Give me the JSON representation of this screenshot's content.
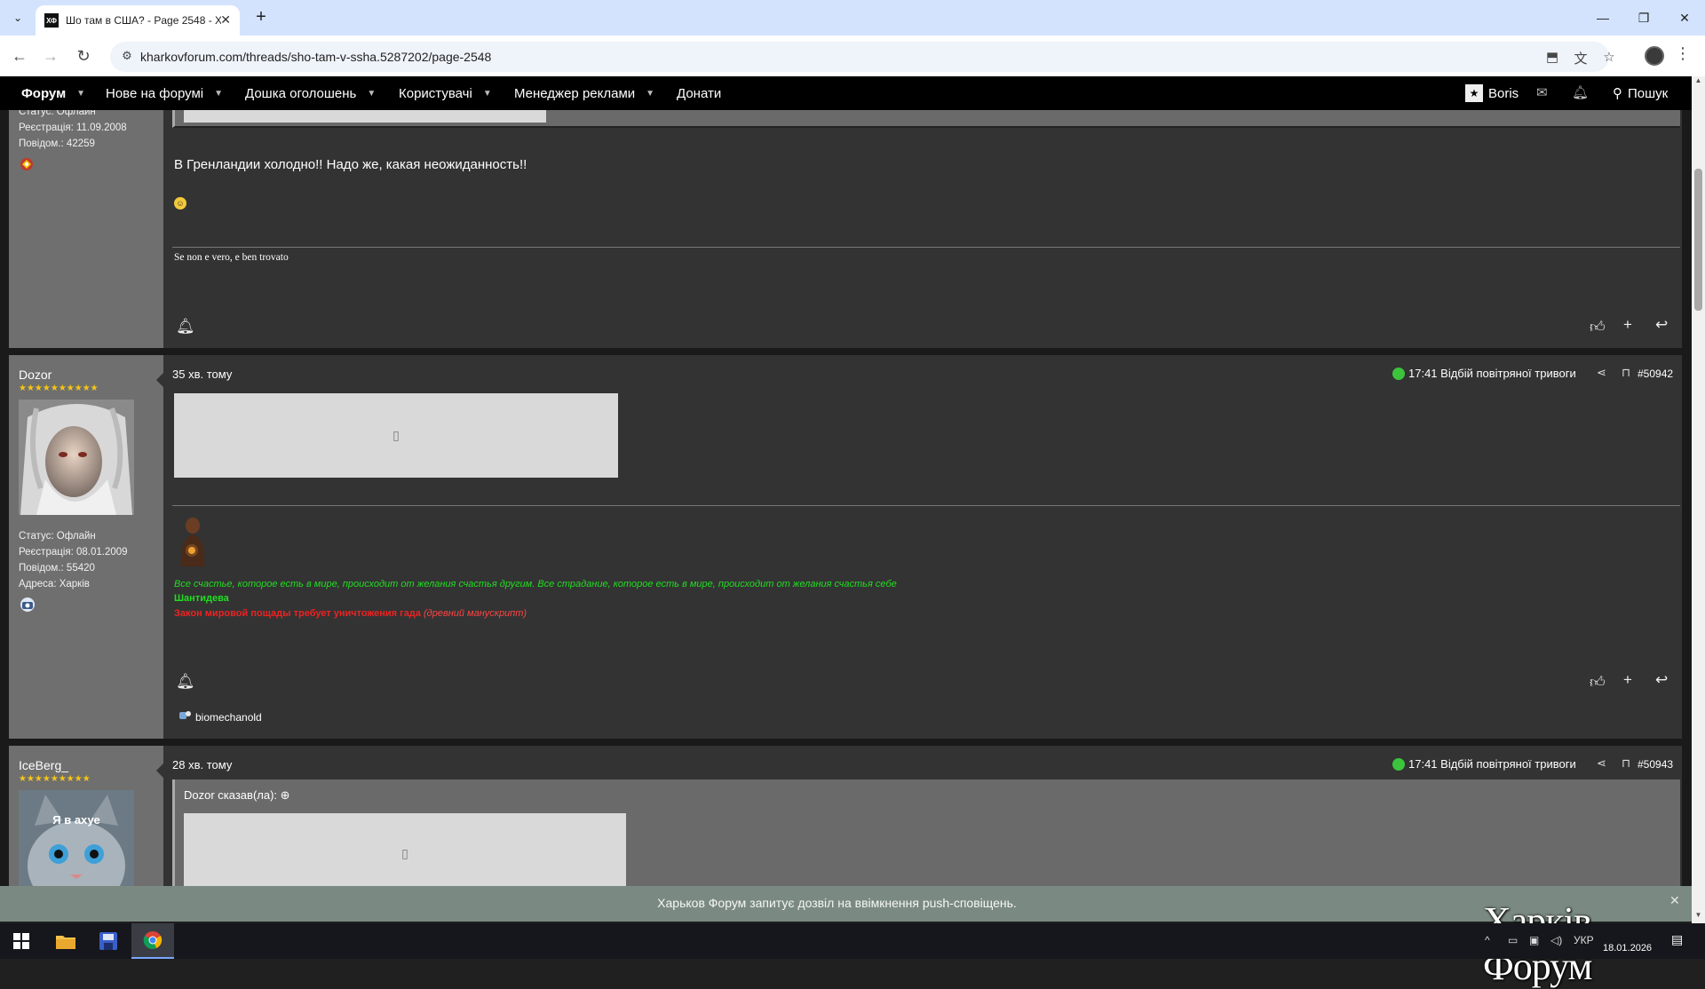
{
  "browser": {
    "tab_favicon": "ХФ",
    "tab_title": "Шо там в США? - Page 2548 - Х",
    "url": "kharkovforum.com/threads/sho-tam-v-ssha.5287202/page-2548"
  },
  "nav": {
    "items": [
      {
        "label": "Форум"
      },
      {
        "label": "Нове на форумі"
      },
      {
        "label": "Дошка оголошень"
      },
      {
        "label": "Користувачі"
      },
      {
        "label": "Менеджер реклами"
      },
      {
        "label": "Донати"
      }
    ],
    "user": "Boris",
    "search": "Пошук"
  },
  "post1": {
    "status": "Статус: Офлайн",
    "registered": "Реєстрація: 11.09.2008",
    "posts": "Повідом.: 42259",
    "text": "В Гренландии холодно!! Надо же, какая неожиданность!!",
    "signature": "Se non e vero, e ben trovato"
  },
  "post2": {
    "username": "Dozor",
    "stars": "★★★★★★★★★★",
    "status": "Статус: Офлайн",
    "registered": "Реєстрація: 08.01.2009",
    "posts": "Повідом.: 55420",
    "address": "Адреса: Харків",
    "time": "35 хв. тому",
    "alert": "17:41 Відбій повітряної тривоги",
    "number": "#50942",
    "sig_line1": "Все счастье, которое есть в мире, происходит от желания счастья другим. Все страдание, которое есть в мире, происходит от желания счастья себе",
    "sig_line2": "Шантидева",
    "sig_line3": "Закон мировой пощады требует уничтожения гада",
    "sig_line3b": "(древний манускрипт)",
    "liked_by": "biomechanold"
  },
  "post3": {
    "username": "IceBerg_",
    "stars": "★★★★★★★★★",
    "avatar_text": "Я в ахуе",
    "time": "28 хв. тому",
    "alert": "17:41 Відбій повітряної тривоги",
    "number": "#50943",
    "quote_author": "Dozor сказав(ла):"
  },
  "push": {
    "text": "Харьков Форум запитує дозвіл на ввімкнення push-сповіщень.",
    "watermark": "Харків Форум"
  },
  "taskbar": {
    "lang": "УКР",
    "date": "18.01.2026"
  },
  "colors": {
    "tabstrip": "#d3e3fd",
    "nav_bg": "#000000",
    "user_panel": "#6f6f6f",
    "post_bg": "#333333",
    "green_sig": "#22dd22",
    "red_sig": "#ee2222",
    "alert_dot": "#3cc43c"
  }
}
